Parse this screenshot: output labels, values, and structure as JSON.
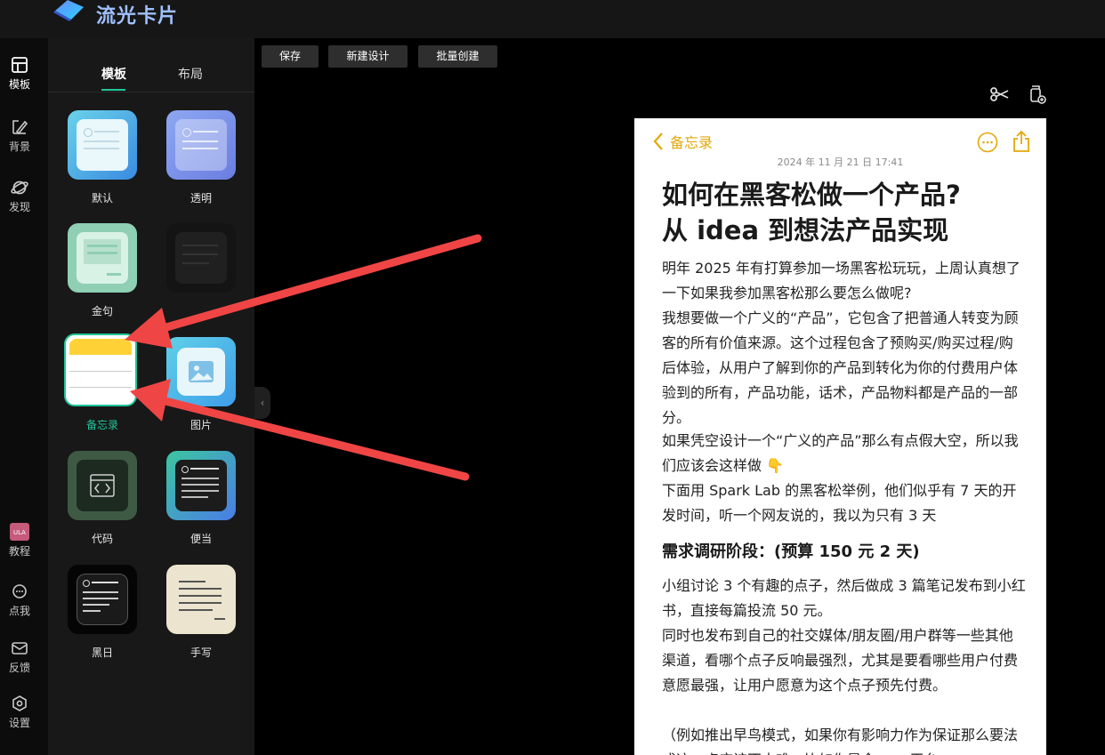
{
  "app": {
    "title": "流光卡片"
  },
  "rail": {
    "items": [
      {
        "label": "模板",
        "icon": "template-icon"
      },
      {
        "label": "背景",
        "icon": "background-icon"
      },
      {
        "label": "发现",
        "icon": "discover-icon"
      },
      {
        "label": "教程",
        "icon": "tutorial-icon"
      },
      {
        "label": "点我",
        "icon": "chat-icon"
      },
      {
        "label": "反馈",
        "icon": "feedback-icon"
      },
      {
        "label": "设置",
        "icon": "settings-icon"
      }
    ]
  },
  "panel": {
    "tabs": [
      {
        "label": "模板",
        "active": true
      },
      {
        "label": "布局",
        "active": false
      }
    ],
    "templates": [
      {
        "label": "默认"
      },
      {
        "label": "透明"
      },
      {
        "label": "金句"
      },
      {
        "label": ""
      },
      {
        "label": "备忘录",
        "selected": true
      },
      {
        "label": "图片"
      },
      {
        "label": "代码"
      },
      {
        "label": "便当"
      },
      {
        "label": "黑日"
      },
      {
        "label": "手写"
      }
    ]
  },
  "toolbar": {
    "save": "保存",
    "new_design": "新建设计",
    "batch_create": "批量创建"
  },
  "card": {
    "back": "备忘录",
    "date": "2024 年 11 月 21 日 17:41",
    "title_line1": "如何在黑客松做一个产品?",
    "title_line2": "从 idea 到想法产品实现",
    "p1": "明年 2025 年有打算参加一场黑客松玩玩，上周认真想了一下如果我参加黑客松那么要怎么做呢?",
    "p2": "我想要做一个广义的“产品”，它包含了把普通人转变为顾客的所有价值来源。这个过程包含了预购买/购买过程/购后体验，从用户了解到你的产品到转化为你的付费用户体验到的所有，产品功能，话术，产品物料都是产品的一部分。",
    "p3": "如果凭空设计一个“广义的产品”那么有点假大空，所以我们应该会这样做 👇",
    "p4": "下面用 Spark Lab 的黑客松举例，他们似乎有 7 天的开发时间，听一个网友说的，我以为只有 3 天",
    "heading": "需求调研阶段：(预算 150 元 2 天)",
    "p5": "小组讨论 3 个有趣的点子，然后做成 3 篇笔记发布到小红书，直接每篇投流 50 元。",
    "p6": "同时也发布到自己的社交媒体/朋友圈/用户群等一些其他渠道，看哪个点子反响最强烈，尤其是要看哪些用户付费意愿最强，让用户愿意为这个点子预先付费。",
    "p7": "（例如推出早鸟模式，如果你有影响力作为保证那么要法成这一点应该不太难，比如你是全 xxx 平台"
  },
  "colors": {
    "accent": "#21c59b",
    "memo_yellow": "#e3a808",
    "arrow": "#f04545"
  }
}
